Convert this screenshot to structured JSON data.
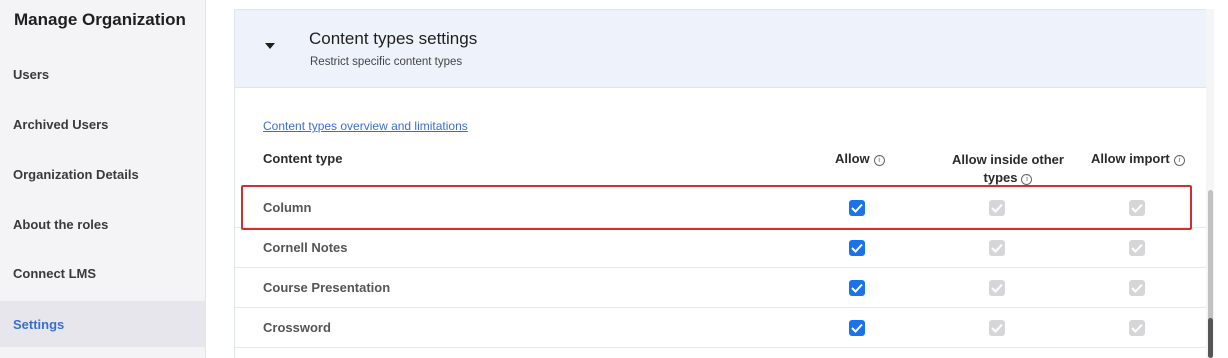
{
  "sidebar": {
    "title": "Manage Organization",
    "items": [
      {
        "label": "Users"
      },
      {
        "label": "Archived Users"
      },
      {
        "label": "Organization Details"
      },
      {
        "label": "About the roles"
      },
      {
        "label": "Connect LMS"
      },
      {
        "label": "Settings",
        "active": true
      }
    ]
  },
  "panel": {
    "title": "Content types settings",
    "subtitle": "Restrict specific content types",
    "overview_link": "Content types overview and limitations",
    "columns": {
      "content_type": "Content type",
      "allow": "Allow",
      "allow_inside_line1": "Allow inside other",
      "allow_inside_line2": "types",
      "allow_import": "Allow import"
    },
    "rows": [
      {
        "label": "Column",
        "allow": true,
        "allow_inside": "disabled-checked",
        "allow_import": "disabled-checked",
        "highlighted": true
      },
      {
        "label": "Cornell Notes",
        "allow": true,
        "allow_inside": "disabled-checked",
        "allow_import": "disabled-checked"
      },
      {
        "label": "Course Presentation",
        "allow": true,
        "allow_inside": "disabled-checked",
        "allow_import": "disabled-checked"
      },
      {
        "label": "Crossword",
        "allow": true,
        "allow_inside": "disabled-checked",
        "allow_import": "disabled-checked"
      }
    ]
  },
  "colors": {
    "accent": "#1a73e8",
    "link": "#3a6fd1",
    "highlight_border": "#d32f2f",
    "header_bg": "#eef2fb"
  }
}
